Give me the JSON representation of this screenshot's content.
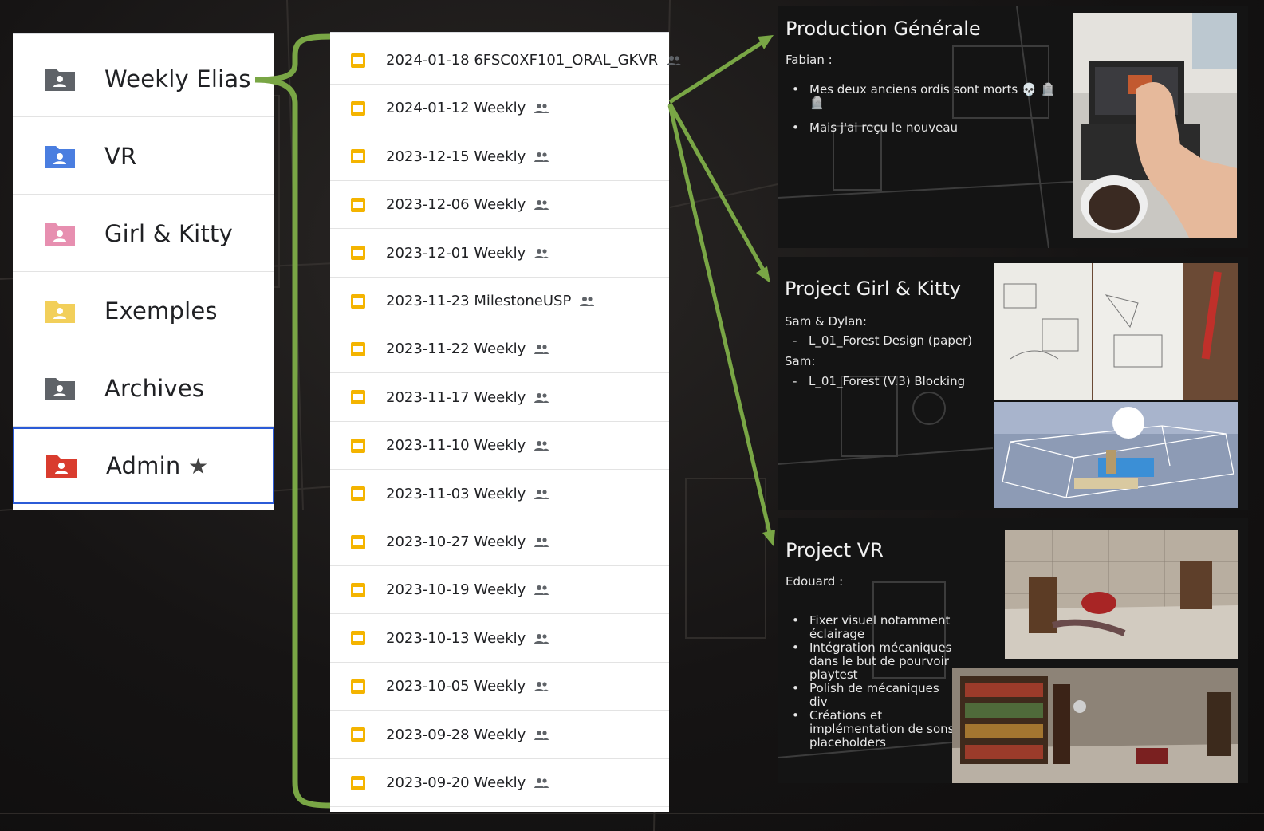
{
  "folders": [
    {
      "label": "Weekly Elias",
      "color": "#5f6368"
    },
    {
      "label": "VR",
      "color": "#4a7ee0"
    },
    {
      "label": "Girl & Kitty",
      "color": "#e78fb0"
    },
    {
      "label": "Exemples",
      "color": "#f2cf5a"
    },
    {
      "label": "Archives",
      "color": "#5f6368"
    },
    {
      "label": "Admin",
      "color": "#d93c2e",
      "starred": true
    }
  ],
  "files": [
    {
      "name": "2024-01-18 6FSC0XF101_ORAL_GKVR"
    },
    {
      "name": "2024-01-12 Weekly"
    },
    {
      "name": "2023-12-15 Weekly"
    },
    {
      "name": "2023-12-06 Weekly"
    },
    {
      "name": "2023-12-01 Weekly"
    },
    {
      "name": "2023-11-23 MilestoneUSP"
    },
    {
      "name": "2023-11-22 Weekly"
    },
    {
      "name": "2023-11-17 Weekly"
    },
    {
      "name": "2023-11-10 Weekly"
    },
    {
      "name": "2023-11-03 Weekly"
    },
    {
      "name": "2023-10-27 Weekly"
    },
    {
      "name": "2023-10-19 Weekly"
    },
    {
      "name": "2023-10-13 Weekly"
    },
    {
      "name": "2023-10-05 Weekly"
    },
    {
      "name": "2023-09-28 Weekly"
    },
    {
      "name": "2023-09-20 Weekly"
    }
  ],
  "slides": {
    "production": {
      "title": "Production Générale",
      "person": "Fabian :",
      "bullets": [
        "Mes deux anciens ordis sont morts 💀 🪦 🪦",
        "Mais j'ai reçu le nouveau"
      ]
    },
    "girlkitty": {
      "title": "Project Girl & Kitty",
      "person1": "Sam & Dylan:",
      "item1": "L_01_Forest Design (paper)",
      "person2": "Sam:",
      "item2": "L_01_Forest (V.3) Blocking"
    },
    "vr": {
      "title": "Project VR",
      "person": "Edouard :",
      "bullets": [
        "Fixer visuel notamment éclairage",
        "Intégration mécaniques dans le but de pourvoir playtest",
        "Polish de mécaniques div",
        "Créations et implémentation de sons placeholders"
      ]
    }
  },
  "colors": {
    "bracket": "#79a645",
    "slides_icon": "#f4b400",
    "selected_border": "#2b5bd7"
  }
}
